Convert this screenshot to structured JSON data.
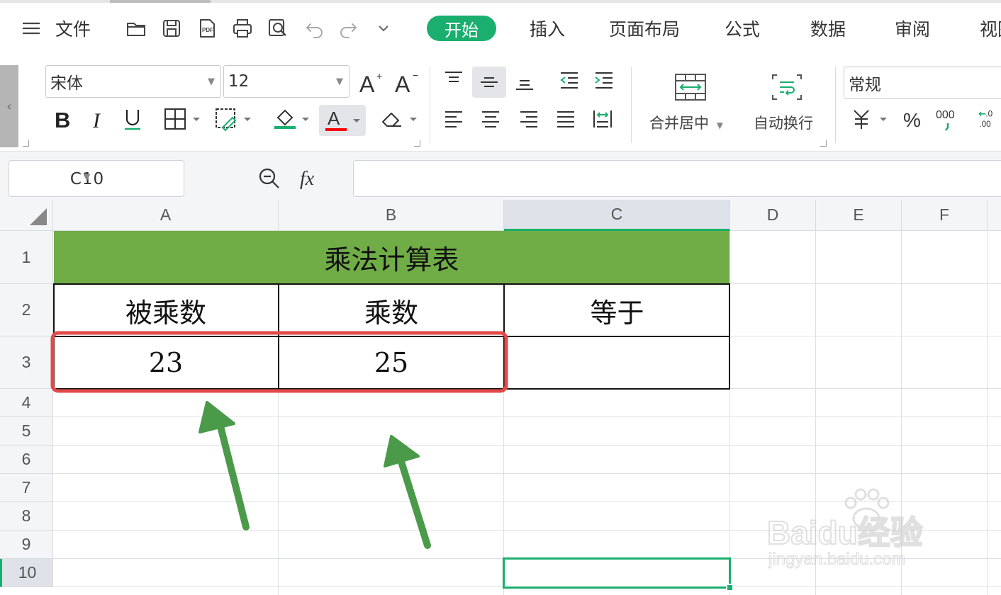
{
  "menu": {
    "file_label": "文件",
    "tabs": [
      {
        "label": "开始",
        "active": true
      },
      {
        "label": "插入"
      },
      {
        "label": "页面布局"
      },
      {
        "label": "公式"
      },
      {
        "label": "数据"
      },
      {
        "label": "审阅"
      },
      {
        "label": "视图"
      }
    ]
  },
  "ribbon": {
    "font_name": "宋体",
    "font_size": "12",
    "merge_center_label": "合并居中",
    "wrap_text_label": "自动换行",
    "number_format": "常规",
    "accent_color": "#1aae6f",
    "font_color_bar": "#ff0000",
    "fill_color_bar": "#1aae6f"
  },
  "formula_bar": {
    "cell_ref": "C10",
    "formula": ""
  },
  "grid": {
    "columns": [
      "A",
      "B",
      "C",
      "D",
      "E",
      "F"
    ],
    "rows": [
      "1",
      "2",
      "3",
      "4",
      "5",
      "6",
      "7",
      "8",
      "9",
      "10"
    ],
    "selected_column": "C",
    "selected_row": "10"
  },
  "sheet": {
    "title": "乘法计算表",
    "title_fill": "#70ad47",
    "headers": [
      "被乘数",
      "乘数",
      "等于"
    ],
    "values": [
      "23",
      "25",
      ""
    ]
  },
  "annotations": {
    "highlight_color": "#e24a4a",
    "arrow_color": "#4a9a4a"
  },
  "watermark": {
    "brand": "Baidu经验",
    "url": "jingyan.baidu.com"
  }
}
